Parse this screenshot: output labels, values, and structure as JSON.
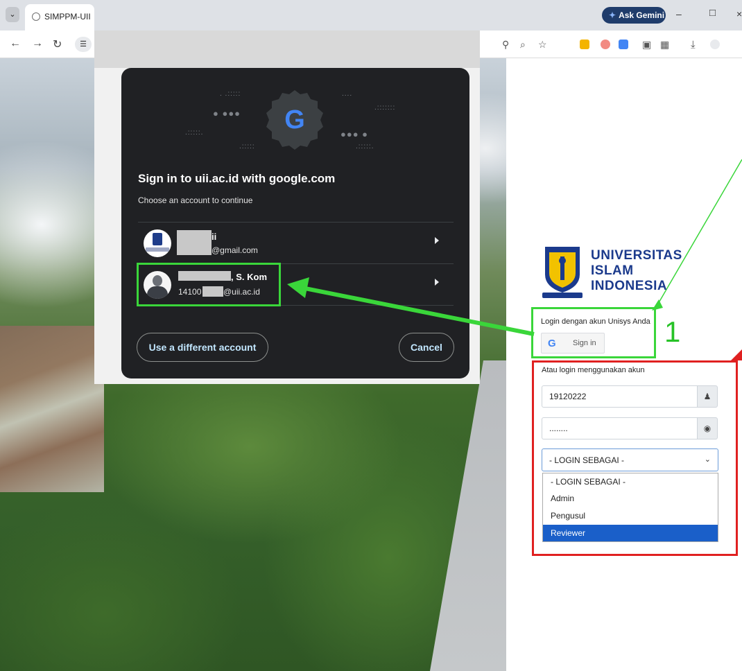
{
  "browser": {
    "tab_title": "SIMPPM-UII",
    "gemini_label": "Ask Gemini",
    "tab_menu_icon": "chevron-down-icon",
    "nav_icons": [
      "back-arrow-icon",
      "forward-arrow-icon",
      "reload-icon",
      "site-info-icon"
    ],
    "toolbar_icons": [
      "key-icon",
      "zoom-icon",
      "bookmark-star-icon",
      "extension-icon",
      "download-icon",
      "profile-icon"
    ]
  },
  "google_dialog": {
    "title": "Sign in to uii.ac.id with google.com",
    "subtitle": "Choose an account to continue",
    "accounts": [
      {
        "name_suffix": "ii",
        "email_suffix": "@gmail.com"
      },
      {
        "name_suffix": ", S. Kom",
        "email_prefix": "14100",
        "email_suffix": "@uii.ac.id"
      }
    ],
    "use_different_label": "Use a different account",
    "cancel_label": "Cancel",
    "google_letter": "G"
  },
  "annotation": {
    "step_number": "1"
  },
  "login": {
    "logo_lines": [
      "UNIVERSITAS",
      "ISLAM",
      "INDONESIA"
    ],
    "unisys_label": "Login dengan akun Unisys Anda",
    "signin_label": "Sign in",
    "alt_label": "Atau login menggunakan akun",
    "username_value": "19120222",
    "password_value": "........",
    "role_selected": "- LOGIN SEBAGAI -",
    "role_options": [
      "- LOGIN SEBAGAI -",
      "Admin",
      "Pengusul",
      "Reviewer"
    ],
    "role_highlighted": "Reviewer"
  },
  "colors": {
    "annotation_green": "#3ad63a",
    "annotation_red": "#e02020",
    "uii_blue": "#1b3a8c",
    "dialog_bg": "#202124",
    "highlight_blue": "#1a5fc9"
  }
}
